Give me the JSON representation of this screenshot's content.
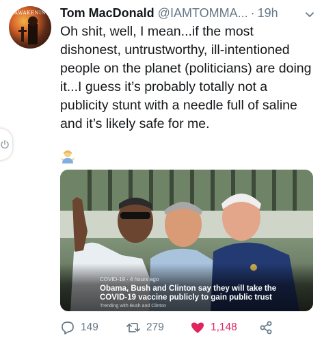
{
  "tweet": {
    "author_name": "Tom MacDonald",
    "author_handle": "@IAMTOMMA...",
    "separator": "·",
    "time": "19h",
    "avatar_text": "AWAKENING",
    "text": "Oh shit, well, I mean...if the most dishonest, untrustworthy, ill-intentioned people on the planet (politicians) are doing it...I guess it’s probably totally not a publicity stunt with a needle full of saline and it’s likely safe for me.",
    "emoji": "person-shrugging-emoji"
  },
  "card": {
    "meta": "COVID-19 · 4 hours ago",
    "headline": "Obama, Bush and Clinton say they will take the COVID-19 vaccine publicly to gain public trust",
    "trending": "Trending with Bush and Clinton"
  },
  "actions": {
    "replies": "149",
    "retweets": "279",
    "likes": "1,148"
  },
  "colors": {
    "text": "#14171a",
    "secondary": "#657786",
    "like": "#e0245e"
  }
}
